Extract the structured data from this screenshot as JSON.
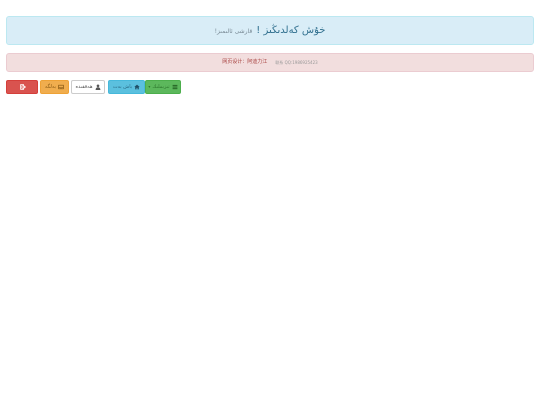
{
  "header": {
    "title": "خۇش كەلدىڭىز !",
    "subtitle": "قارشى ئالىمىز!"
  },
  "notice": {
    "text": "网页设计：阿迪力江",
    "contact": "联系 QQ:1986925423"
  },
  "toolbar": {
    "buttons": [
      {
        "label": "",
        "icon": "exit-icon",
        "color": "#d9534f"
      },
      {
        "label": "بەلگە",
        "icon": "inbox-icon",
        "color": "#f0ad4e"
      },
      {
        "label": "ھەققىدە",
        "icon": "user-icon",
        "color": "#ffffff"
      },
      {
        "label": "باش بەت",
        "icon": "home-icon",
        "color": "#5bc0de"
      },
      {
        "label": "تىزىملىك",
        "icon": "list-icon",
        "color": "#5cb85c"
      }
    ]
  }
}
